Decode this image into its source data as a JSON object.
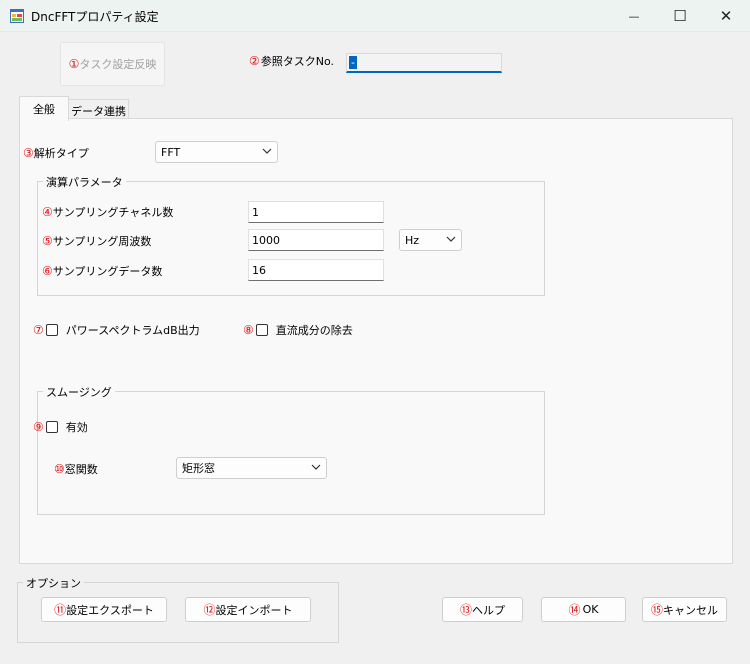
{
  "window": {
    "title": "DncFFTプロパティ設定",
    "minimize_glyph": "—",
    "maximize_glyph": "☐",
    "close_glyph": "✕"
  },
  "top": {
    "apply_task": {
      "num": "①",
      "label": "タスク設定反映"
    },
    "ref_task": {
      "num": "②",
      "label": "参照タスクNo.",
      "value": "-"
    }
  },
  "tabs": [
    {
      "label": "全般"
    },
    {
      "label": "データ連携"
    }
  ],
  "general": {
    "analysis_type": {
      "num": "③",
      "label": "解析タイプ",
      "value": "FFT"
    },
    "calc_params": {
      "title": "演算パラメータ",
      "channels": {
        "num": "④",
        "label": "サンプリングチャネル数",
        "value": "1"
      },
      "frequency": {
        "num": "⑤",
        "label": "サンプリング周波数",
        "value": "1000",
        "unit": "Hz"
      },
      "data_count": {
        "num": "⑥",
        "label": "サンプリングデータ数",
        "value": "16"
      }
    },
    "power_spectrum": {
      "num": "⑦",
      "label": "パワースペクトラムdB出力"
    },
    "dc_removal": {
      "num": "⑧",
      "label": "直流成分の除去"
    },
    "smoothing": {
      "title": "スムージング",
      "enabled": {
        "num": "⑨",
        "label": "有効"
      },
      "window_fn": {
        "num": "⑩",
        "label": "窓関数",
        "value": "矩形窓"
      }
    }
  },
  "options": {
    "title": "オプション",
    "export": {
      "num": "⑪",
      "label": "設定エクスポート"
    },
    "import": {
      "num": "⑫",
      "label": "設定インポート"
    }
  },
  "buttons": {
    "help": {
      "num": "⑬",
      "label": "ヘルプ"
    },
    "ok": {
      "num": "⑭",
      "label": "OK"
    },
    "cancel": {
      "num": "⑮",
      "label": "キャンセル"
    }
  }
}
